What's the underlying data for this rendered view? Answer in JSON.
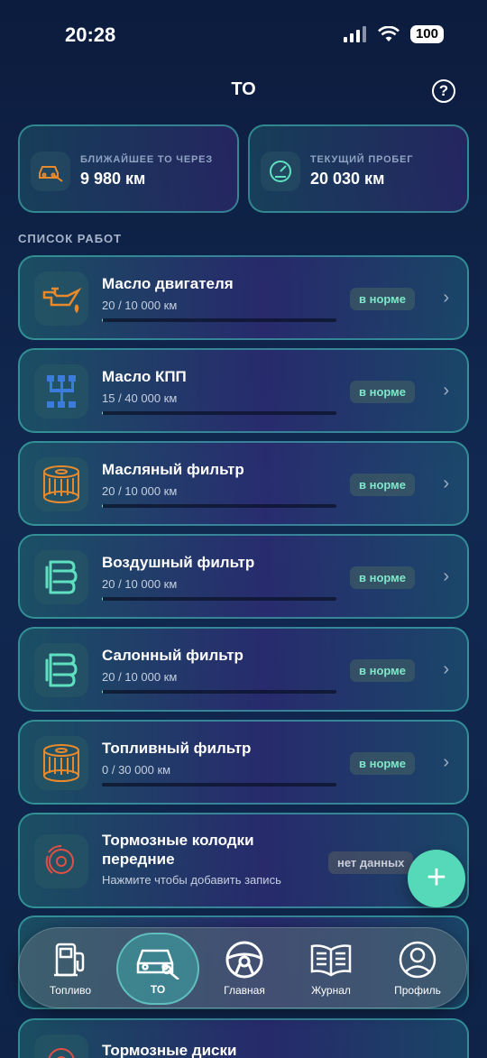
{
  "status_bar": {
    "time": "20:28",
    "battery": "100"
  },
  "header": {
    "title": "ТО",
    "help": "?"
  },
  "stats": {
    "next": {
      "label": "БЛИЖАЙШЕЕ ТО ЧЕРЕЗ",
      "value": "9 980 км",
      "icon": "car-wrench-icon"
    },
    "mileage": {
      "label": "ТЕКУЩИЙ ПРОБЕГ",
      "value": "20 030 км",
      "icon": "speedometer-icon"
    }
  },
  "section_title": "СПИСОК РАБОТ",
  "works": [
    {
      "name": "Масло двигателя",
      "progress": "20 / 10 000 км",
      "fraction": 0.002,
      "badge": "в норме",
      "icon": "oil-can-icon"
    },
    {
      "name": "Масло КПП",
      "progress": "15 / 40 000 км",
      "fraction": 0.0004,
      "badge": "в норме",
      "icon": "gearbox-icon"
    },
    {
      "name": "Масляный фильтр",
      "progress": "20 / 10 000 км",
      "fraction": 0.002,
      "badge": "в норме",
      "icon": "oil-filter-icon"
    },
    {
      "name": "Воздушный фильтр",
      "progress": "20 / 10 000 км",
      "fraction": 0.002,
      "badge": "в норме",
      "icon": "air-filter-icon"
    },
    {
      "name": "Салонный фильтр",
      "progress": "20 / 10 000 км",
      "fraction": 0.002,
      "badge": "в норме",
      "icon": "cabin-filter-icon"
    },
    {
      "name": "Топливный фильтр",
      "progress": "0 / 30 000 км",
      "fraction": 0,
      "badge": "в норме",
      "icon": "fuel-filter-icon"
    },
    {
      "name_line1": "Тормозные колодки",
      "name_line2": "передние",
      "subtitle": "Нажмите чтобы добавить запись",
      "badge": "нет данных",
      "icon": "brake-pads-icon"
    },
    {
      "name": "Тормозные диски",
      "icon": "brake-disc-icon"
    }
  ],
  "fab": "+",
  "tabs": [
    {
      "label": "Топливо",
      "icon": "fuel-pump-icon"
    },
    {
      "label": "ТО",
      "icon": "car-service-icon",
      "active": true
    },
    {
      "label": "Главная",
      "icon": "steering-wheel-icon"
    },
    {
      "label": "Журнал",
      "icon": "book-icon"
    },
    {
      "label": "Профиль",
      "icon": "profile-icon"
    }
  ],
  "colors": {
    "accent": "#55d9b8",
    "badge_text": "#7fe8c8",
    "icon_orange": "#e8892c",
    "icon_blue": "#3a7bdc",
    "icon_teal": "#5fe0c0"
  }
}
